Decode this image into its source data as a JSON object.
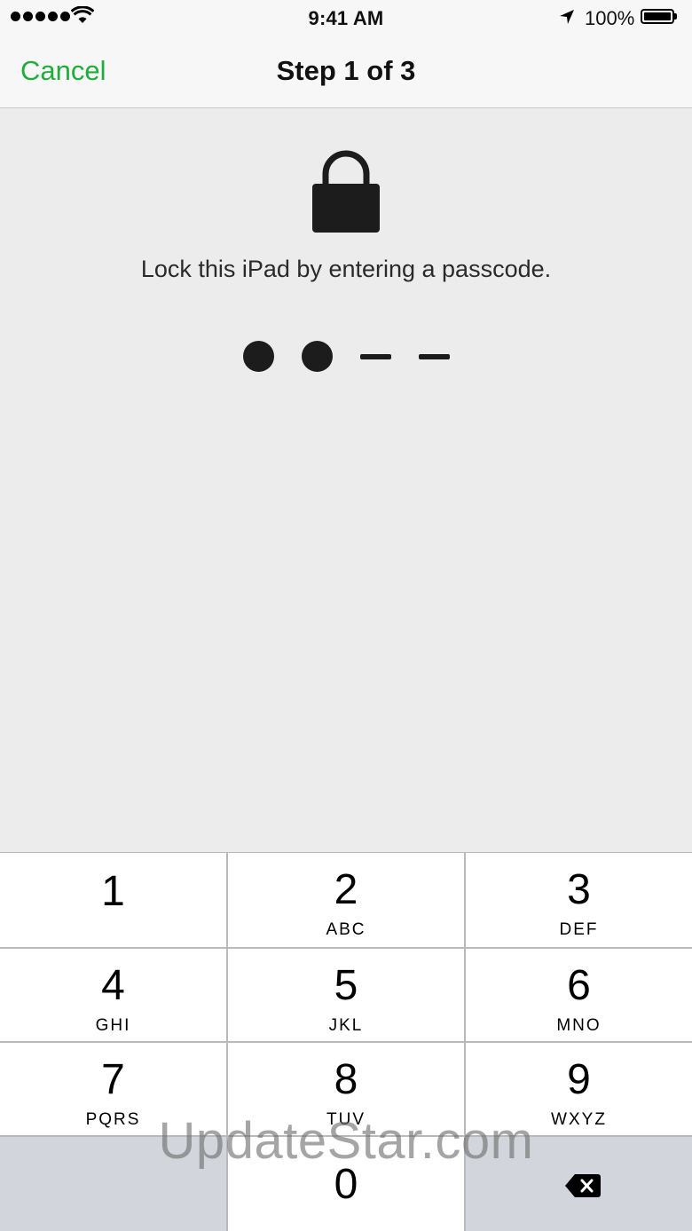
{
  "status_bar": {
    "time": "9:41 AM",
    "battery_percent": "100%",
    "signal_bars": 5,
    "icons": [
      "signal-dots-icon",
      "wifi-icon",
      "location-arrow-icon",
      "battery-icon"
    ]
  },
  "nav": {
    "cancel_label": "Cancel",
    "title": "Step 1 of 3"
  },
  "lock": {
    "icon": "padlock-icon",
    "prompt": "Lock this iPad by entering a passcode."
  },
  "passcode": {
    "length": 4,
    "entered": 2
  },
  "keypad": {
    "keys": [
      {
        "digit": "1",
        "letters": ""
      },
      {
        "digit": "2",
        "letters": "ABC"
      },
      {
        "digit": "3",
        "letters": "DEF"
      },
      {
        "digit": "4",
        "letters": "GHI"
      },
      {
        "digit": "5",
        "letters": "JKL"
      },
      {
        "digit": "6",
        "letters": "MNO"
      },
      {
        "digit": "7",
        "letters": "PQRS"
      },
      {
        "digit": "8",
        "letters": "TUV"
      },
      {
        "digit": "9",
        "letters": "WXYZ"
      }
    ],
    "zero": "0",
    "delete_icon": "backspace-icon"
  },
  "watermark": "UpdateStar.com",
  "colors": {
    "accent": "#1fae3a",
    "background": "#ececec",
    "bar": "#f7f7f7",
    "key": "#ffffff",
    "key_gray": "#d2d5db"
  }
}
